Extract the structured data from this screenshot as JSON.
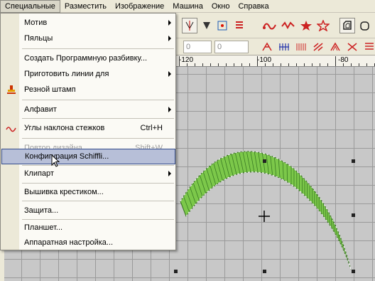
{
  "menubar": {
    "items": [
      "Специальные",
      "Разместить",
      "Изображение",
      "Машина",
      "Окно",
      "Справка"
    ]
  },
  "toolbar2": {
    "spin1_value": "0",
    "spin2_value": "0"
  },
  "ruler": {
    "labels": [
      "-120",
      "-100",
      "-80"
    ]
  },
  "menu": {
    "items": [
      {
        "label": "Мотив",
        "shortcut": "",
        "submenu": true
      },
      {
        "label": "Пяльцы",
        "shortcut": "",
        "submenu": true
      },
      {
        "label": "Создать Программную разбивку...",
        "shortcut": "",
        "submenu": false
      },
      {
        "label": "Приготовить линии для",
        "shortcut": "",
        "submenu": true
      },
      {
        "label": "Резной штамп",
        "shortcut": "",
        "submenu": false
      },
      {
        "label": "Алфавит",
        "shortcut": "",
        "submenu": true
      },
      {
        "label": "Углы наклона стежков",
        "shortcut": "Ctrl+H",
        "submenu": false
      },
      {
        "label": "Повтор дизайна...",
        "shortcut": "Shift+W",
        "submenu": false
      },
      {
        "label": "Конфигурация Schiffli...",
        "shortcut": "",
        "submenu": false
      },
      {
        "label": "Клипарт",
        "shortcut": "",
        "submenu": true
      },
      {
        "label": "Вышивка крестиком...",
        "shortcut": "",
        "submenu": false
      },
      {
        "label": "Защита...",
        "shortcut": "",
        "submenu": false
      },
      {
        "label": "Планшет...",
        "shortcut": "",
        "submenu": false
      },
      {
        "label": "Аппаратная настройка...",
        "shortcut": "",
        "submenu": false
      }
    ]
  },
  "colors": {
    "stitch_green": "#7cc84a",
    "menu_highlight": "#b7bfd8",
    "highlight_border": "#324a8a"
  }
}
